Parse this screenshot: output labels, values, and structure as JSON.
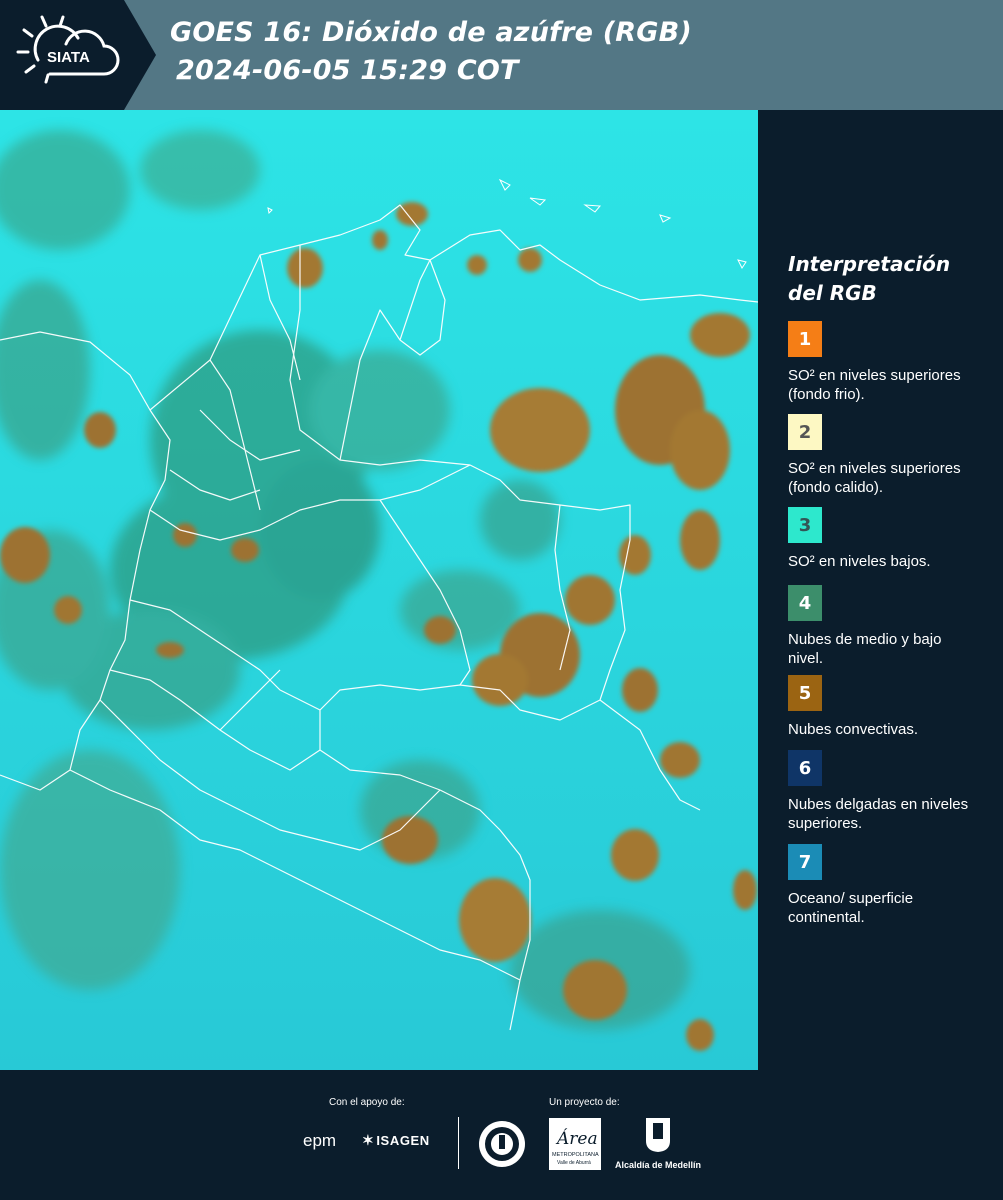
{
  "header": {
    "logo_text": "SIATA",
    "title_line1": "GOES 16: Dióxido de azúfre (RGB)",
    "title_line2": "2024-06-05 15:29 COT"
  },
  "legend": {
    "title_line1": "Interpretación",
    "title_line2": "del RGB",
    "items": [
      {
        "number": "1",
        "color": "#f57e16",
        "number_color": "#ffffff",
        "text": "SO² en niveles superiores (fondo frio)."
      },
      {
        "number": "2",
        "color": "#fdf8c3",
        "number_color": "#555555",
        "text": "SO² en niveles superiores (fondo calido)."
      },
      {
        "number": "3",
        "color": "#2de8cd",
        "number_color": "#335555",
        "text": "SO² en niveles bajos."
      },
      {
        "number": "4",
        "color": "#3c8e6b",
        "number_color": "#ffffff",
        "text": "Nubes de medio y bajo nivel."
      },
      {
        "number": "5",
        "color": "#9b6412",
        "number_color": "#ffffff",
        "text": "Nubes convectivas."
      },
      {
        "number": "6",
        "color": "#0f3567",
        "number_color": "#ffffff",
        "text": "Nubes delgadas en niveles superiores."
      },
      {
        "number": "7",
        "color": "#1b8cb6",
        "number_color": "#ffffff",
        "text": "Oceano/ superficie continental."
      }
    ]
  },
  "footer": {
    "support_label": "Con el apoyo de:",
    "project_label": "Un proyecto de:",
    "epm_text": "epm",
    "isagen_text": "ISAGEN",
    "area_text": "Área",
    "area_subtext": "METROPOLITANA",
    "area_subtext2": "Valle de Aburrá",
    "alcaldia_text": "Alcaldía de Medellín"
  },
  "colors": {
    "header_bg": "#537785",
    "page_bg": "#0b1d2c",
    "map_cyan": "#22e3e8",
    "cloud_brown": "#9b7430",
    "cloud_green": "#3c8e6b"
  }
}
